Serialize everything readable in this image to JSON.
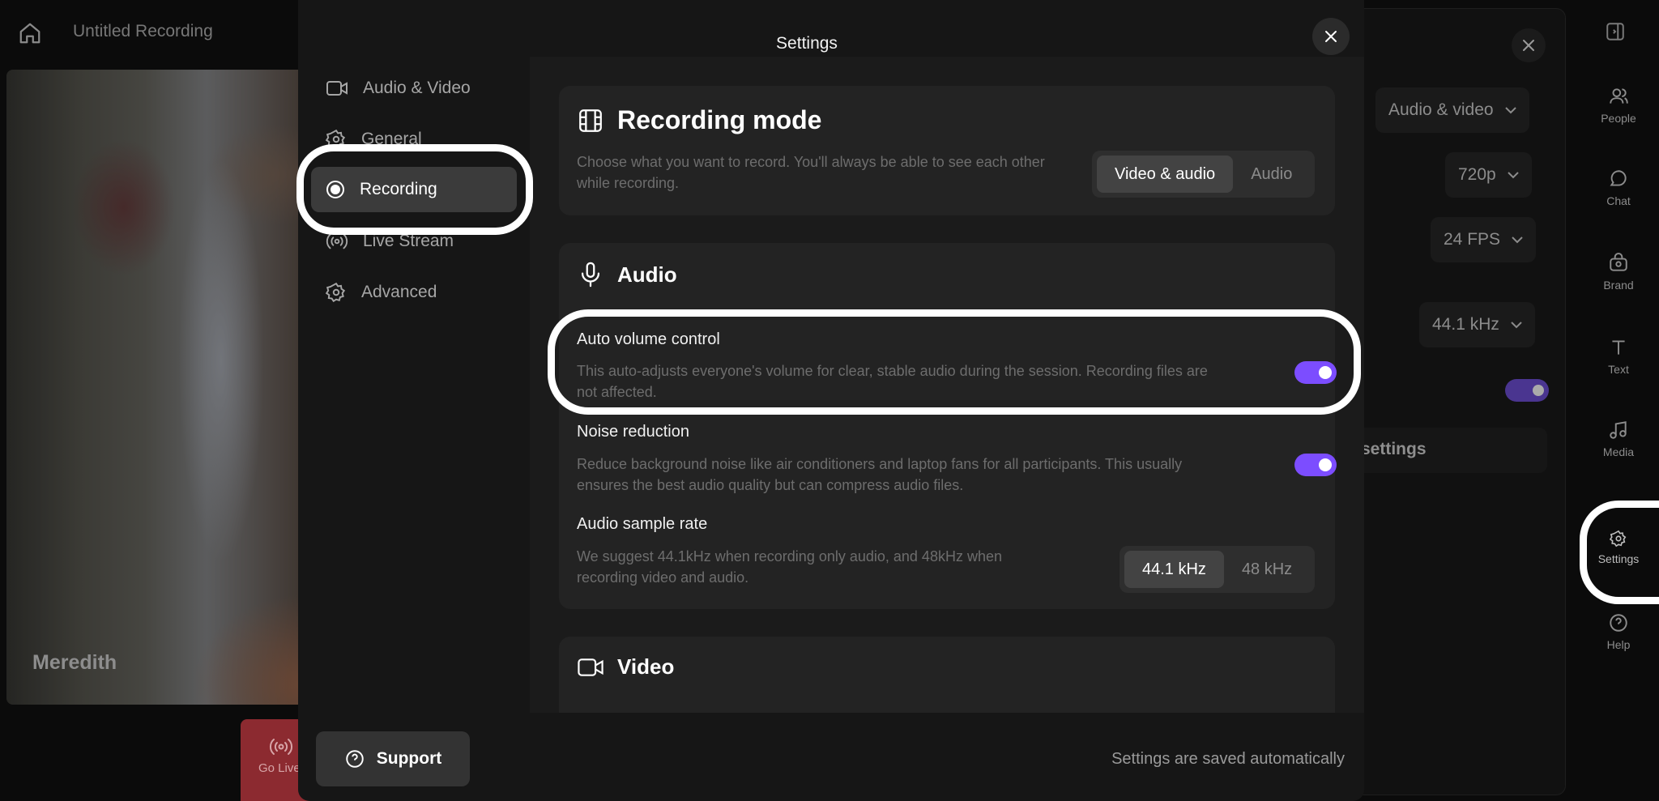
{
  "app": {
    "recording_title": "Untitled Recording",
    "participant_name": "Meredith",
    "go_live_label": "Go Live"
  },
  "background_panel": {
    "layout_dropdown": "Audio & video",
    "resolution_dropdown": "720p",
    "fps_dropdown": "24 FPS",
    "sample_rate_dropdown": "44.1 kHz",
    "settings_link": "settings"
  },
  "right_rail": {
    "items": [
      {
        "label": "People",
        "icon": "people-icon"
      },
      {
        "label": "Chat",
        "icon": "chat-icon"
      },
      {
        "label": "Brand",
        "icon": "brand-icon"
      },
      {
        "label": "Text",
        "icon": "text-icon"
      },
      {
        "label": "Media",
        "icon": "music-icon"
      },
      {
        "label": "Settings",
        "icon": "gear-icon"
      },
      {
        "label": "Help",
        "icon": "help-icon"
      }
    ]
  },
  "modal": {
    "title": "Settings",
    "nav": [
      {
        "label": "Audio & Video",
        "icon": "camera-icon"
      },
      {
        "label": "General",
        "icon": "gear-icon"
      },
      {
        "label": "Recording",
        "icon": "record-icon",
        "active": true
      },
      {
        "label": "Live Stream",
        "icon": "broadcast-icon"
      },
      {
        "label": "Advanced",
        "icon": "gear-icon"
      }
    ],
    "recording_mode": {
      "title": "Recording mode",
      "description": "Choose what you want to record. You'll always be able to see each other while recording.",
      "options": [
        "Video & audio",
        "Audio"
      ],
      "selected": "Video & audio"
    },
    "audio": {
      "title": "Audio",
      "auto_volume": {
        "label": "Auto volume control",
        "description": "This auto-adjusts everyone's volume for clear, stable audio during the session. Recording files are not affected.",
        "enabled": true
      },
      "noise_reduction": {
        "label": "Noise reduction",
        "description": "Reduce background noise like air conditioners and laptop fans for all participants. This usually ensures the best audio quality but can compress audio files.",
        "enabled": true
      },
      "sample_rate": {
        "label": "Audio sample rate",
        "description": "We suggest 44.1kHz when recording only audio, and 48kHz when recording video and audio.",
        "options": [
          "44.1 kHz",
          "48 kHz"
        ],
        "selected": "44.1 kHz"
      }
    },
    "video": {
      "title": "Video"
    },
    "support_label": "Support",
    "saved_note": "Settings are saved automatically"
  },
  "colors": {
    "accent": "#7c4dff",
    "modal_bg": "#161616",
    "card_bg": "#232323",
    "go_live": "#8c2a30"
  }
}
